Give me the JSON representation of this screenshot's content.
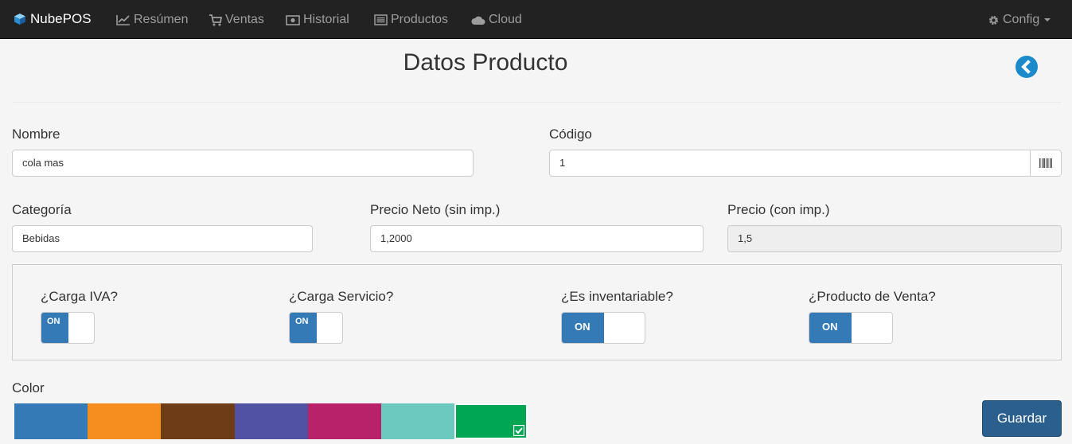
{
  "navbar": {
    "brand": "NubePOS",
    "items": [
      {
        "label": "Resúmen",
        "icon": "line-chart-icon"
      },
      {
        "label": "Ventas",
        "icon": "shopping-cart-icon"
      },
      {
        "label": "Historial",
        "icon": "money-icon"
      },
      {
        "label": "Productos",
        "icon": "list-alt-icon"
      },
      {
        "label": "Cloud",
        "icon": "cloud-icon"
      }
    ],
    "config_label": "Config"
  },
  "page": {
    "title": "Datos Producto"
  },
  "form": {
    "nombre": {
      "label": "Nombre",
      "value": "cola mas"
    },
    "codigo": {
      "label": "Código",
      "value": "1"
    },
    "categoria": {
      "label": "Categoría",
      "value": "Bebidas"
    },
    "precio_neto": {
      "label": "Precio Neto (sin imp.)",
      "value": "1,2000"
    },
    "precio": {
      "label": "Precio (con imp.)",
      "value": "1,5"
    }
  },
  "switches": [
    {
      "label": "¿Carga IVA?",
      "state": "ON"
    },
    {
      "label": "¿Carga Servicio?",
      "state": "ON"
    },
    {
      "label": "¿Es inventariable?",
      "state": "ON"
    },
    {
      "label": "¿Producto de Venta?",
      "state": "ON"
    }
  ],
  "color": {
    "label": "Color",
    "swatches": [
      "#337ab7",
      "#f68e1f",
      "#6f3c18",
      "#5252a3",
      "#b8226a",
      "#6cc9bf",
      "#00a651"
    ],
    "selected_index": 6
  },
  "actions": {
    "save_label": "Guardar"
  }
}
